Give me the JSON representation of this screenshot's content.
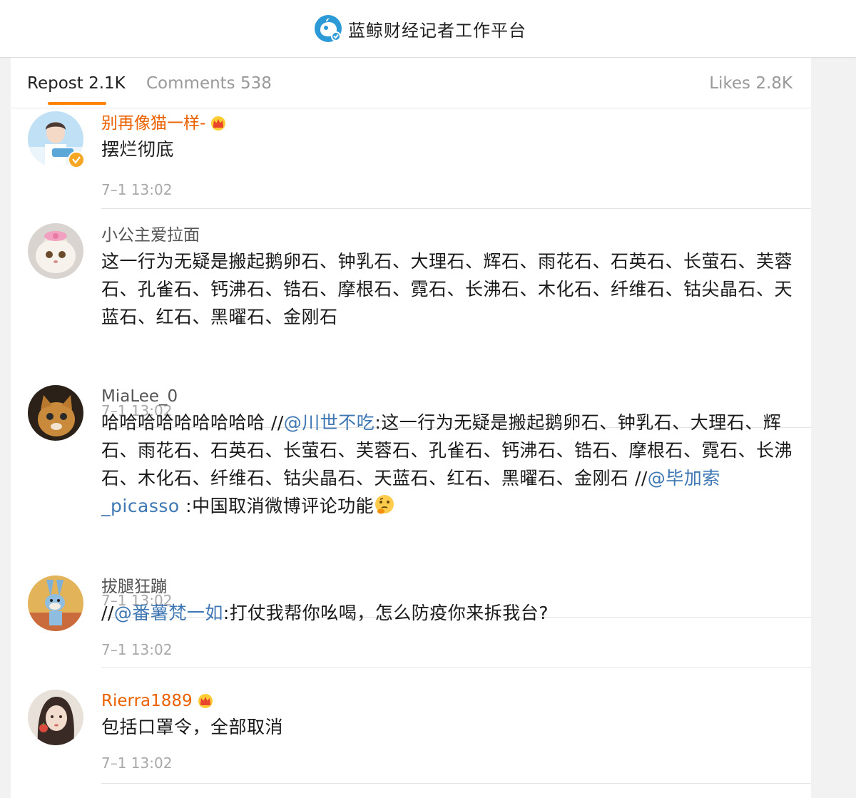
{
  "app": {
    "title": "蓝鲸财经记者工作平台",
    "brand_color": "#2d9ad8"
  },
  "tabs": [
    {
      "label": "Repost 2.1K",
      "active": true
    },
    {
      "label": "Comments 538",
      "active": false
    },
    {
      "label": "Likes 2.8K",
      "active": false
    }
  ],
  "accent_color": "#ff8200",
  "comments": [
    {
      "username": "别再像猫一样-",
      "vip": true,
      "verified": true,
      "avatar": "avatar-boy-icon",
      "text": "摆烂彻底",
      "time": "7–1 13:02"
    },
    {
      "username": "小公主爱拉面",
      "vip": false,
      "avatar": "avatar-cat-white-icon",
      "text": "这一行为无疑是搬起鹅卵石、钟乳石、大理石、辉石、雨花石、石英石、长萤石、芙蓉石、孔雀石、钙沸石、锆石、摩根石、霓石、长沸石、木化石、纤维石、钴尖晶石、天蓝石、红石、黑曜石、金刚石",
      "time": "7–1 13:02"
    },
    {
      "username": "MiaLee_0",
      "vip": false,
      "avatar": "avatar-cat-orange-icon",
      "text_part1": "哈哈哈哈哈哈哈哈哈 //",
      "mention1": "@川世不吃",
      "text_part2": ":这一行为无疑是搬起鹅卵石、钟乳石、大理石、辉石、雨花石、石英石、长萤石、芙蓉石、孔雀石、钙沸石、锆石、摩根石、霓石、长沸石、木化石、纤维石、钴尖晶石、天蓝石、红石、黑曜石、金刚石 //",
      "mention2": "@毕加索_picasso",
      "text_part3": " :中国取消微博评论功能",
      "emoji": "thinking-face-icon",
      "time": "7–1 13:02"
    },
    {
      "username": "拔腿狂蹦",
      "vip": false,
      "avatar": "avatar-cartoon-rabbit-icon",
      "text_part1": "//",
      "mention1": "@番薯梵一如",
      "text_part2": ":打仗我帮你吆喝，怎么防疫你来拆我台?",
      "time": "7–1 13:02"
    },
    {
      "username": "Rierra1889",
      "vip": true,
      "avatar": "avatar-girl-icon",
      "text": "包括口罩令，全部取消",
      "time": "7–1 13:02"
    }
  ]
}
